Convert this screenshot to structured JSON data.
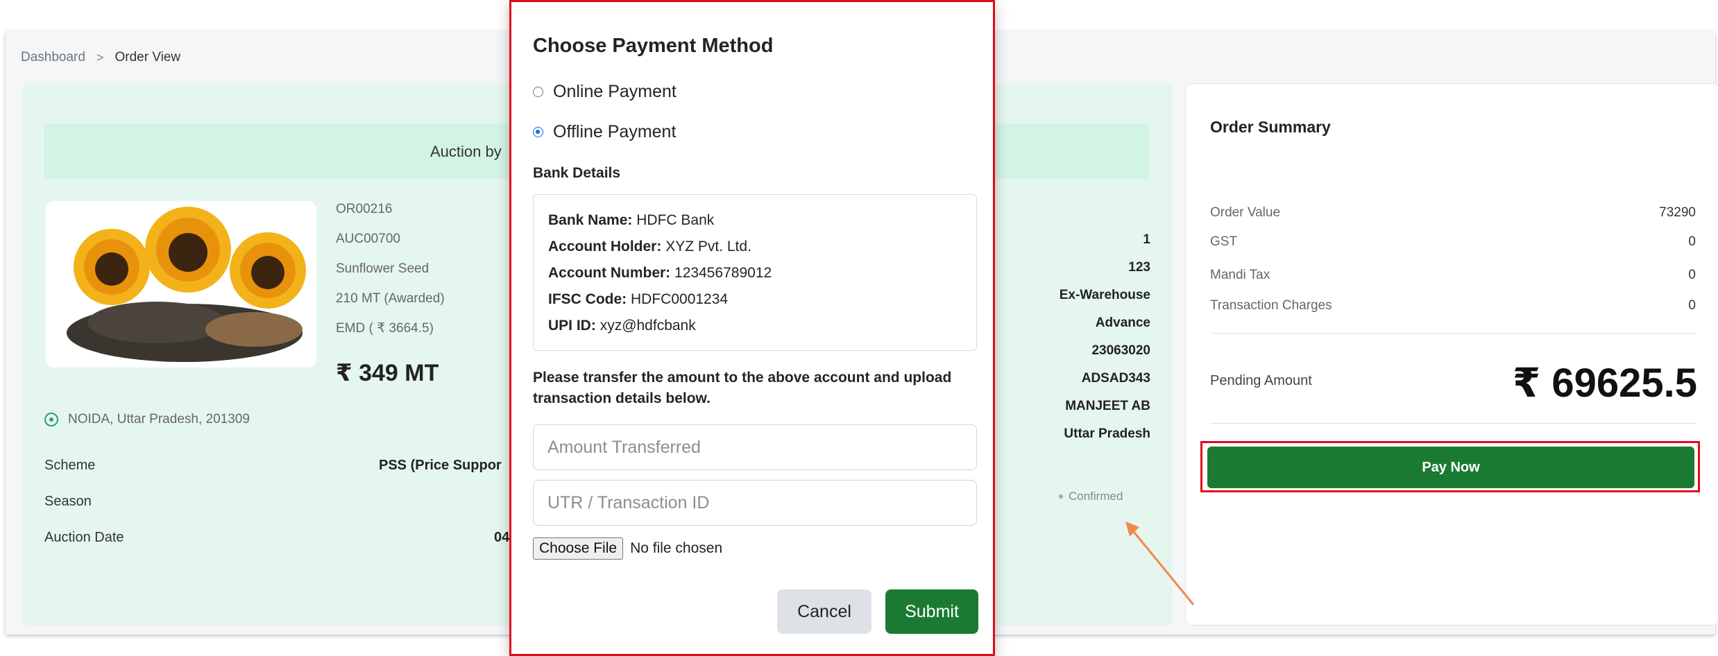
{
  "breadcrumb": {
    "home": "Dashboard",
    "separator": ">",
    "current": "Order View"
  },
  "order": {
    "banner_text": "Auction by",
    "id": "OR00216",
    "auction_id": "AUC00700",
    "product": "Sunflower Seed",
    "quantity": "210 MT (Awarded)",
    "emd": "EMD ( ₹ 3664.5)",
    "price": "₹ 349 MT",
    "location": "NOIDA, Uttar Pradesh, 201309",
    "scheme_label": "Scheme",
    "scheme_value": "PSS (Price Suppor",
    "season_label": "Season",
    "auction_date_label": "Auction Date",
    "auction_date_value": "04",
    "right_values": [
      "1",
      "123",
      "Ex-Warehouse",
      "Advance",
      "23063020",
      "ADSAD343",
      "MANJEET AB",
      "Uttar Pradesh"
    ],
    "status": "Confirmed"
  },
  "summary": {
    "title": "Order Summary",
    "rows": [
      {
        "label": "Order Value",
        "value": "73290"
      },
      {
        "label": "GST",
        "value": "0"
      },
      {
        "label": "Mandi Tax",
        "value": "0"
      },
      {
        "label": "Transaction Charges",
        "value": "0"
      }
    ],
    "pending_label": "Pending Amount",
    "pending_amount": "₹ 69625.5",
    "pay_button": "Pay Now"
  },
  "modal": {
    "title": "Choose Payment Method",
    "options": [
      {
        "label": "Online Payment",
        "selected": false
      },
      {
        "label": "Offline Payment",
        "selected": true
      }
    ],
    "bank_heading": "Bank Details",
    "bank": [
      {
        "key": "Bank Name:",
        "value": "HDFC Bank"
      },
      {
        "key": "Account Holder:",
        "value": "XYZ Pvt. Ltd."
      },
      {
        "key": "Account Number:",
        "value": "123456789012"
      },
      {
        "key": "IFSC Code:",
        "value": "HDFC0001234"
      },
      {
        "key": "UPI ID:",
        "value": "xyz@hdfcbank"
      }
    ],
    "note": "Please transfer the amount to the above account and upload transaction details below.",
    "amount_placeholder": "Amount Transferred",
    "utr_placeholder": "UTR / Transaction ID",
    "file_button": "Choose File",
    "file_status": "No file chosen",
    "cancel": "Cancel",
    "submit": "Submit"
  },
  "colors": {
    "accent_green": "#1a7a32",
    "highlight_red": "#e5091a",
    "card_mint": "#e5f6ef",
    "arrow": "#f08a4b"
  }
}
